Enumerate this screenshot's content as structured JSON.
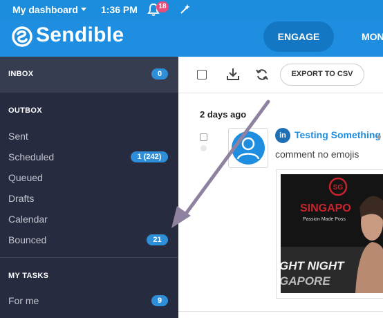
{
  "topbar": {
    "dashboard_label": "My dashboard",
    "time": "1:36 PM",
    "notification_count": "18"
  },
  "header": {
    "brand": "Sendible",
    "nav_engage": "ENGAGE",
    "nav_partial": "MON"
  },
  "sidebar": {
    "inbox": {
      "label": "INBOX",
      "badge": "0"
    },
    "outbox_heading": "OUTBOX",
    "outbox_items": [
      {
        "label": "Sent"
      },
      {
        "label": "Scheduled",
        "badge": "1 (242)"
      },
      {
        "label": "Queued"
      },
      {
        "label": "Drafts"
      },
      {
        "label": "Calendar"
      },
      {
        "label": "Bounced",
        "badge": "21"
      }
    ],
    "tasks_heading": "MY TASKS",
    "task_items": [
      {
        "label": "For me",
        "badge": "9"
      }
    ]
  },
  "toolbar": {
    "export_label": "EXPORT TO CSV"
  },
  "post": {
    "date_heading": "2 days ago",
    "title": "Testing Something",
    "network": "in",
    "text": "comment no emojis",
    "image_lines": [
      "SINGAPO",
      "Passion Made Poss",
      "GHT NIGHT",
      "GAPORE"
    ],
    "image_logo": "SG"
  },
  "colors": {
    "topbar": "#1c8cdc",
    "header": "#1f8ee0",
    "engage_pill": "#1377c4",
    "sidebar": "#262b3f",
    "badge": "#2e8fd8",
    "notification": "#e94b7a",
    "arrow": "#8f82a0"
  }
}
